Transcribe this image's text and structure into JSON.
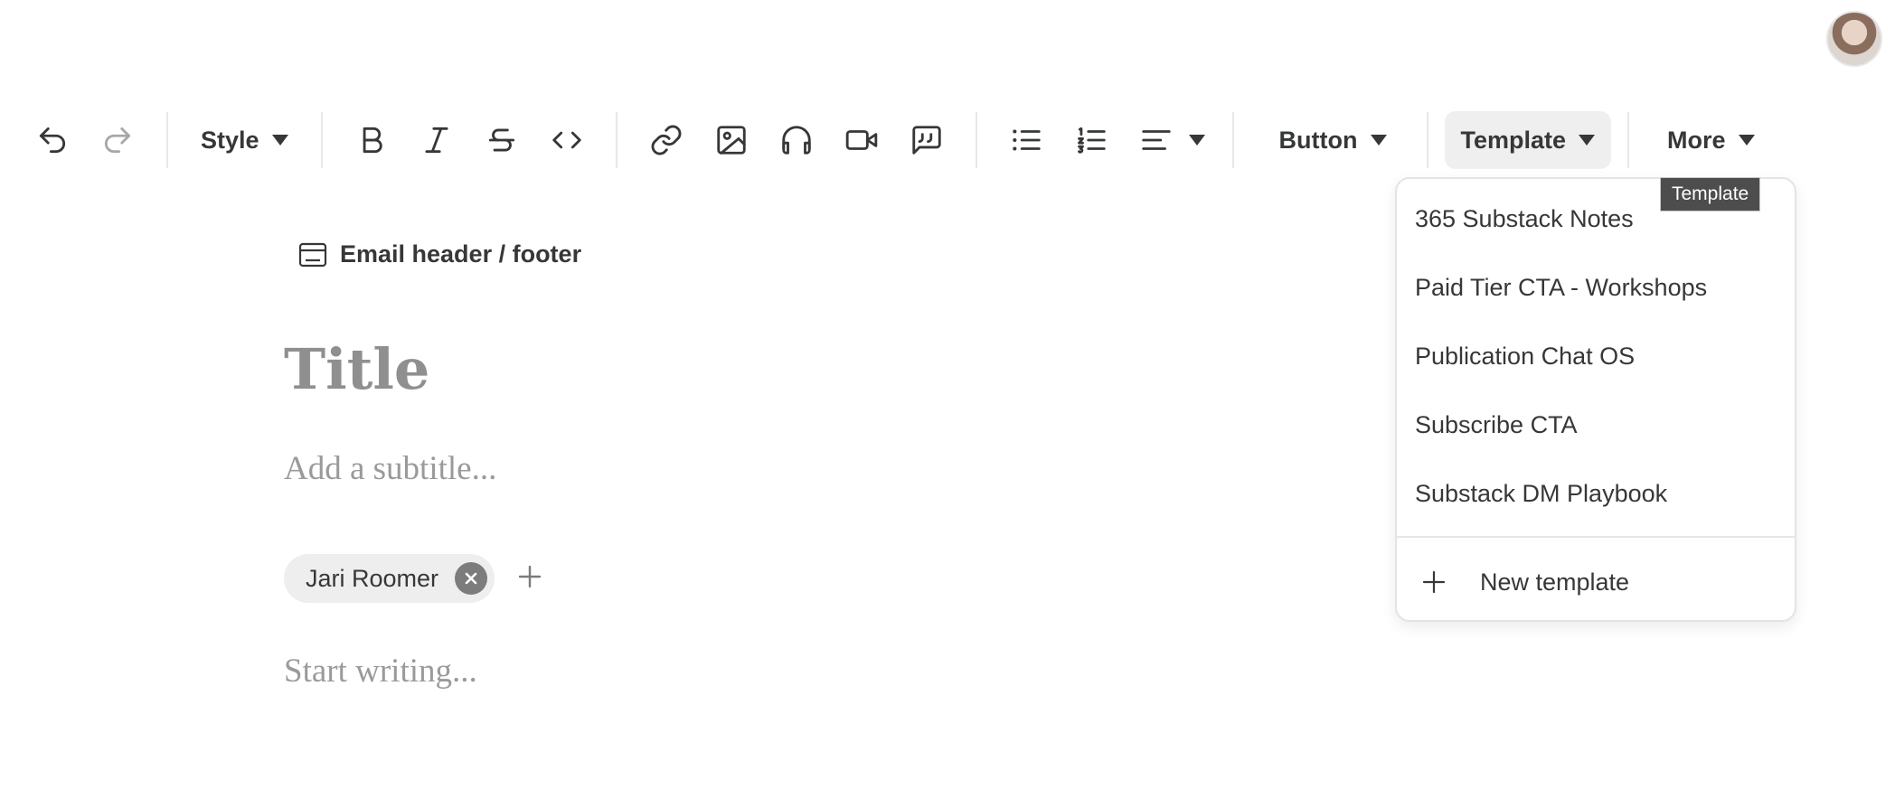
{
  "toolbar": {
    "style_label": "Style",
    "button_label": "Button",
    "template_label": "Template",
    "more_label": "More",
    "icons": [
      "undo-icon",
      "redo-icon",
      "bold-icon",
      "italic-icon",
      "strikethrough-icon",
      "code-icon",
      "link-icon",
      "image-icon",
      "audio-icon",
      "video-icon",
      "quote-icon",
      "bulleted-list-icon",
      "numbered-list-icon",
      "align-icon"
    ]
  },
  "editor": {
    "email_header_footer": "Email header / footer",
    "title_placeholder": "Title",
    "subtitle_placeholder": "Add a subtitle...",
    "author": "Jari Roomer",
    "body_placeholder": "Start writing..."
  },
  "template_menu": {
    "items": [
      "365 Substack Notes",
      "Paid Tier CTA - Workshops",
      "Publication Chat OS",
      "Subscribe CTA",
      "Substack DM Playbook"
    ],
    "new_template": "New template"
  },
  "tooltip": "Template",
  "colors": {
    "text": "#363737",
    "placeholder": "#9a9a9a",
    "tooltip_bg": "#4d4d4d"
  }
}
